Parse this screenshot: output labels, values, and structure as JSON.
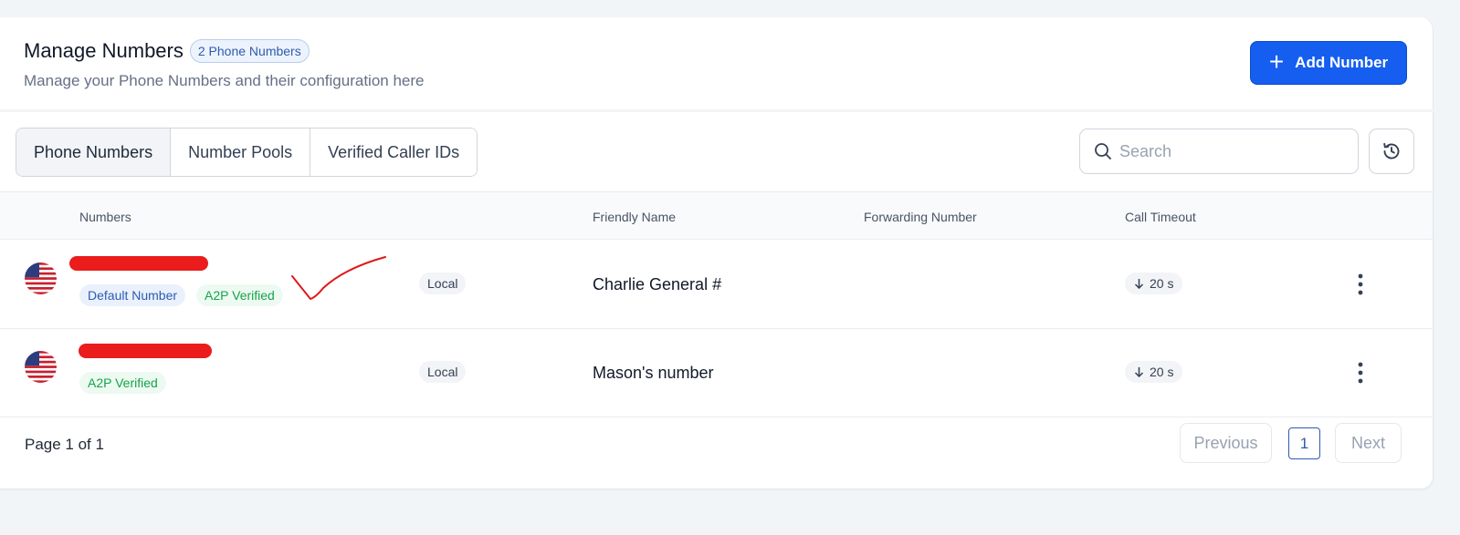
{
  "header": {
    "title": "Manage Numbers",
    "count_badge": "2 Phone Numbers",
    "subtitle": "Manage your Phone Numbers and their configuration here",
    "add_button_label": "Add Number",
    "add_button_icon": "plus-icon"
  },
  "tabs": [
    {
      "label": "Phone Numbers",
      "active": true
    },
    {
      "label": "Number Pools",
      "active": false
    },
    {
      "label": "Verified Caller IDs",
      "active": false
    }
  ],
  "search": {
    "placeholder": "Search",
    "value": ""
  },
  "table": {
    "columns": [
      "Numbers",
      "Friendly Name",
      "Forwarding Number",
      "Call Timeout"
    ],
    "rows": [
      {
        "flag": "us-flag-icon",
        "tags": [
          "Default Number",
          "A2P Verified"
        ],
        "type": "Local",
        "friendly_name": "Charlie General #",
        "forwarding_number": "",
        "call_timeout": "20 s"
      },
      {
        "flag": "us-flag-icon",
        "tags": [
          "A2P Verified"
        ],
        "type": "Local",
        "friendly_name": "Mason's number",
        "forwarding_number": "",
        "call_timeout": "20 s"
      }
    ]
  },
  "pagination": {
    "status": "Page 1 of 1",
    "previous_label": "Previous",
    "current_page": "1",
    "next_label": "Next"
  },
  "colors": {
    "primary": "#155eef",
    "verified_green": "#16a34a",
    "badge_blue": "#2d5bb0",
    "annotation_red": "#ea1c1c"
  }
}
